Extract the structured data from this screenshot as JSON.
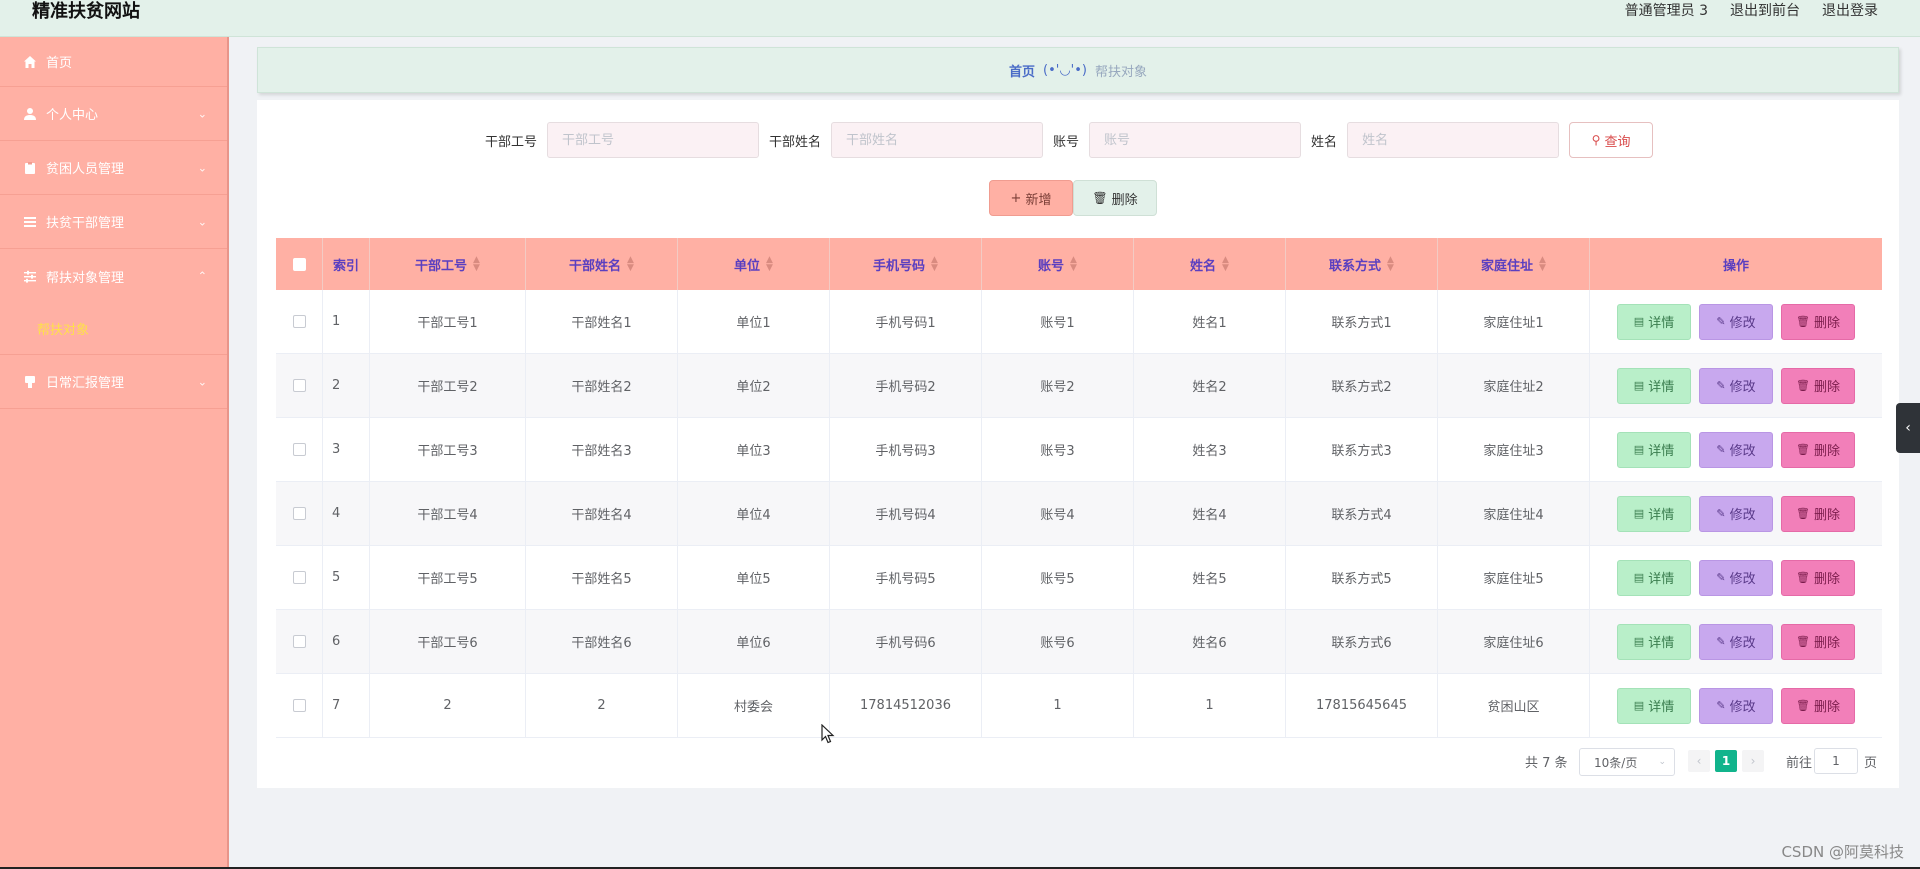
{
  "header": {
    "brand": "精准扶贫网站",
    "links": [
      "普通管理员 3",
      "退出到前台",
      "退出登录"
    ]
  },
  "sidebar": {
    "items": [
      {
        "label": "首页",
        "icon": "home-icon",
        "expandable": false
      },
      {
        "label": "个人中心",
        "icon": "user-icon",
        "expandable": true,
        "expanded": false
      },
      {
        "label": "贫困人员管理",
        "icon": "clipboard-icon",
        "expandable": true,
        "expanded": false
      },
      {
        "label": "扶贫干部管理",
        "icon": "list-icon",
        "expandable": true,
        "expanded": false
      },
      {
        "label": "帮扶对象管理",
        "icon": "sliders-icon",
        "expandable": true,
        "expanded": true
      },
      {
        "label": "日常汇报管理",
        "icon": "report-icon",
        "expandable": true,
        "expanded": false
      }
    ],
    "subitem_active": "帮扶对象"
  },
  "breadcrumb": {
    "home": "首页",
    "face": "(•'◡'•)",
    "current": "帮扶对象"
  },
  "search": {
    "fields": [
      {
        "label": "干部工号",
        "placeholder": "干部工号"
      },
      {
        "label": "干部姓名",
        "placeholder": "干部姓名"
      },
      {
        "label": "账号",
        "placeholder": "账号"
      },
      {
        "label": "姓名",
        "placeholder": "姓名"
      }
    ],
    "query_label": "查询"
  },
  "actions": {
    "add_label": "新增",
    "delete_label": "删除"
  },
  "table": {
    "columns": [
      "索引",
      "干部工号",
      "干部姓名",
      "单位",
      "手机号码",
      "账号",
      "姓名",
      "联系方式",
      "家庭住址",
      "操作"
    ],
    "rows": [
      [
        "1",
        "干部工号1",
        "干部姓名1",
        "单位1",
        "手机号码1",
        "账号1",
        "姓名1",
        "联系方式1",
        "家庭住址1"
      ],
      [
        "2",
        "干部工号2",
        "干部姓名2",
        "单位2",
        "手机号码2",
        "账号2",
        "姓名2",
        "联系方式2",
        "家庭住址2"
      ],
      [
        "3",
        "干部工号3",
        "干部姓名3",
        "单位3",
        "手机号码3",
        "账号3",
        "姓名3",
        "联系方式3",
        "家庭住址3"
      ],
      [
        "4",
        "干部工号4",
        "干部姓名4",
        "单位4",
        "手机号码4",
        "账号4",
        "姓名4",
        "联系方式4",
        "家庭住址4"
      ],
      [
        "5",
        "干部工号5",
        "干部姓名5",
        "单位5",
        "手机号码5",
        "账号5",
        "姓名5",
        "联系方式5",
        "家庭住址5"
      ],
      [
        "6",
        "干部工号6",
        "干部姓名6",
        "单位6",
        "手机号码6",
        "账号6",
        "姓名6",
        "联系方式6",
        "家庭住址6"
      ],
      [
        "7",
        "2",
        "2",
        "村委会",
        "17814512036",
        "1",
        "1",
        "17815645645",
        "贫困山区"
      ]
    ],
    "row_actions": {
      "detail": "详情",
      "edit": "修改",
      "remove": "删除"
    }
  },
  "pagination": {
    "total": "共 7 条",
    "page_size": "10条/页",
    "current_page": "1",
    "goto_label": "前往",
    "goto_value": "1",
    "page_suffix": "页"
  },
  "watermark": "CSDN @阿莫科技",
  "colors": {
    "topbar": "#e3f1ea",
    "sidebar": "#ffb0a4",
    "table_header": "#ffb0a4",
    "header_text": "#5a3fc0",
    "submenu_active": "#ffe04a",
    "detail_btn": "#b9efc9",
    "edit_btn": "#c8a8ee",
    "remove_btn": "#f27fb9",
    "pager_active": "#11b48c"
  }
}
